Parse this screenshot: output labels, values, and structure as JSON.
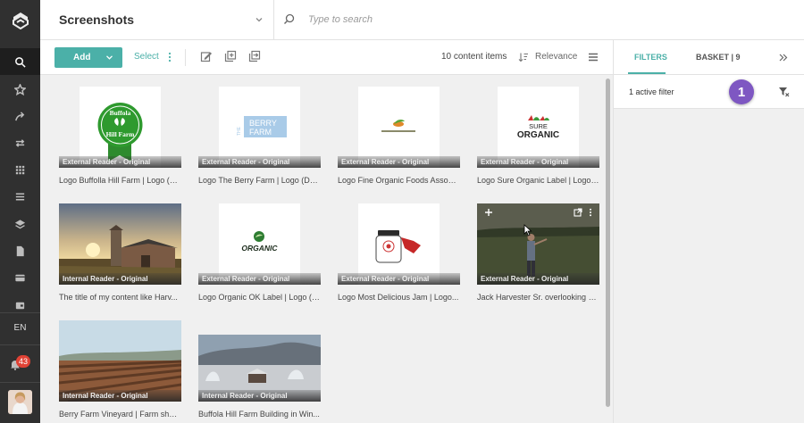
{
  "header": {
    "title": "Screenshots",
    "search_placeholder": "Type to search"
  },
  "toolbar": {
    "add_label": "Add",
    "select_label": "Select",
    "count_label": "10 content items",
    "sort_label": "Relevance"
  },
  "rail": {
    "language": "EN",
    "notifications": "43"
  },
  "panel": {
    "tab_filters": "FILTERS",
    "tab_basket": "BASKET | 9",
    "active_filter_text": "1 active filter",
    "step_marker": "1"
  },
  "items": [
    {
      "badge": "External Reader - Original",
      "caption": "Logo Buffolla Hill Farm | Logo (D...",
      "logo_text": [
        "Buffola",
        "Hill Farm"
      ]
    },
    {
      "badge": "External Reader - Original",
      "caption": "Logo The Berry Farm | Logo (Do...",
      "logo_text": [
        "BERRY",
        "FARM",
        "THE"
      ]
    },
    {
      "badge": "External Reader - Original",
      "caption": "Logo Fine Organic Foods Associ..."
    },
    {
      "badge": "External Reader - Original",
      "caption": "Logo Sure Organic Label | Logo (...",
      "logo_text": [
        "SURE",
        "ORGANIC"
      ]
    },
    {
      "badge": "Internal Reader - Original",
      "caption": "The title of my content like Harv..."
    },
    {
      "badge": "External Reader - Original",
      "caption": "Logo Organic OK Label | Logo (D...",
      "logo_text": [
        "ORGANIC"
      ]
    },
    {
      "badge": "External Reader - Original",
      "caption": "Logo Most Delicious Jam | Logo..."
    },
    {
      "badge": "External Reader - Original",
      "caption": "Jack Harvester Sr. overlooking h..."
    },
    {
      "badge": "Internal Reader - Original",
      "caption": "Berry Farm Vineyard | Farm shot ..."
    },
    {
      "badge": "Internal Reader - Original",
      "caption": "Buffola Hill Farm Building in Win..."
    }
  ],
  "colors": {
    "accent": "#4bb0a8",
    "rail": "#303030",
    "marker": "#7e57c2",
    "badge": "#e04235"
  }
}
